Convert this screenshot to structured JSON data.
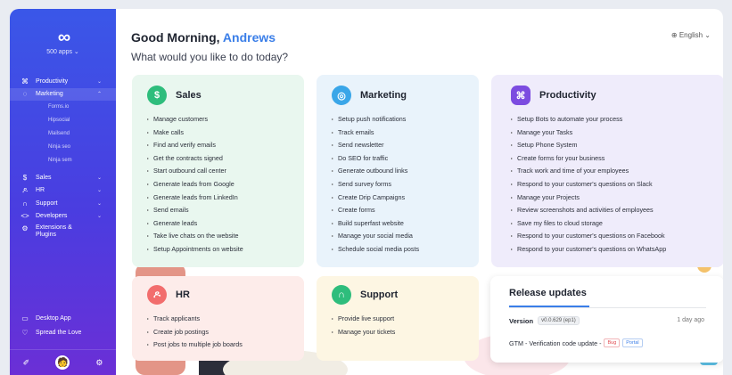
{
  "sidebar": {
    "logo": "∞",
    "apps": "500 apps ⌄",
    "items": [
      {
        "icon": "⌘",
        "label": "Productivity",
        "chev": "⌄"
      },
      {
        "icon": "◌",
        "label": "Marketing",
        "chev": "⌃"
      }
    ],
    "sub_items": [
      "Forms.io",
      "Hipsocial",
      "Mailsend",
      "Ninja seo",
      "Ninja sem"
    ],
    "items2": [
      {
        "icon": "$",
        "label": "Sales",
        "chev": "⌄"
      },
      {
        "icon": "ዶ",
        "label": "HR",
        "chev": "⌄"
      },
      {
        "icon": "∩",
        "label": "Support",
        "chev": "⌄"
      },
      {
        "icon": "<>",
        "label": "Developers",
        "chev": "⌄"
      }
    ],
    "extensions": {
      "icon": "⚙",
      "label": "Extensions & Plugins"
    },
    "bottom": [
      {
        "icon": "▭",
        "label": "Desktop App"
      },
      {
        "icon": "♡",
        "label": "Spread the Love"
      }
    ]
  },
  "header": {
    "greeting": "Good Morning,",
    "name": "Andrews",
    "subtitle": "What would you like to do today?",
    "language": "⊕ English ⌄"
  },
  "cards": {
    "sales": {
      "icon": "$",
      "title": "Sales",
      "items": [
        "Manage customers",
        "Make calls",
        "Find and verify emails",
        "Get the contracts signed",
        "Start outbound call center",
        "Generate leads from Google",
        "Generate leads from LinkedIn",
        "Send emails",
        "Generate leads",
        "Take live chats on the website",
        "Setup Appointments on website"
      ]
    },
    "marketing": {
      "icon": "◎",
      "title": "Marketing",
      "items": [
        "Setup push notifications",
        "Track emails",
        "Send newsletter",
        "Do SEO for traffic",
        "Generate outbound links",
        "Send survey forms",
        "Create Drip Campaigns",
        "Create forms",
        "Build superfast website",
        "Manage your social media",
        "Schedule social media posts"
      ]
    },
    "productivity": {
      "icon": "⌘",
      "title": "Productivity",
      "items": [
        "Setup Bots to automate your process",
        "Manage your Tasks",
        "Setup Phone System",
        "Create forms for your business",
        "Track work and time of your employees",
        "Respond to your customer's questions on Slack",
        "Manage your Projects",
        "Review screenshots and activities of employees",
        "Save my files to cloud storage",
        "Respond to your customer's questions on Facebook",
        "Respond to your customer's questions on WhatsApp"
      ]
    },
    "hr": {
      "icon": "ዶ",
      "title": "HR",
      "items": [
        "Track applicants",
        "Create job postings",
        "Post jobs to multiple job boards"
      ]
    },
    "support": {
      "icon": "∩",
      "title": "Support",
      "items": [
        "Provide live support",
        "Manage your tickets"
      ]
    }
  },
  "release": {
    "title": "Release updates",
    "version_label": "Version",
    "version": "v0.0.629 (ep1)",
    "ago": "1 day ago",
    "update": "GTM - Verification code update -",
    "tag_bug": "Bug",
    "tag_portal": "Portal"
  },
  "colors": {
    "sales": "#2ebd7c",
    "marketing": "#3aa6e8",
    "productivity": "#7c4ce0",
    "hr": "#f26d6d",
    "support": "#2ebd7c",
    "accent": "#3a7ee8"
  }
}
